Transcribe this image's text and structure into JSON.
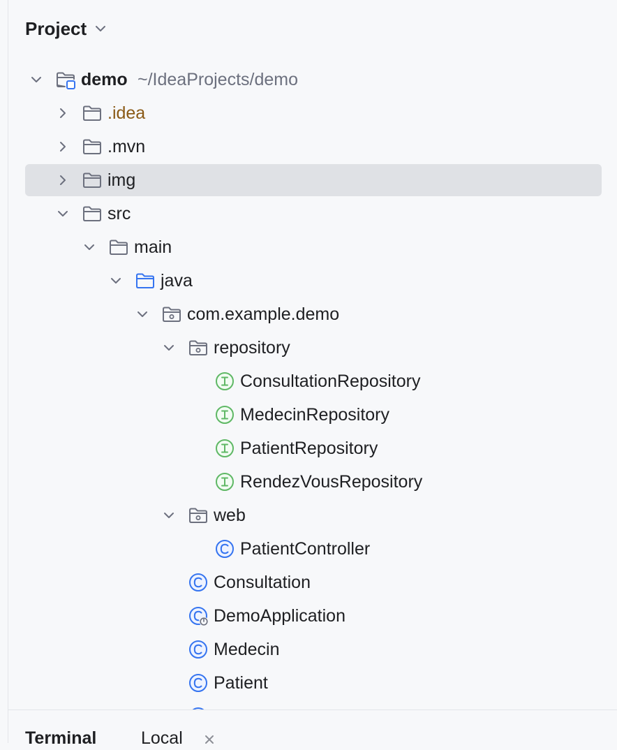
{
  "header": {
    "title": "Project"
  },
  "tree": [
    {
      "label": "demo",
      "hint": "~/IdeaProjects/demo",
      "depth": 0,
      "arrow": "down",
      "icon": "module-folder-icon",
      "bold": true
    },
    {
      "label": ".idea",
      "depth": 1,
      "arrow": "right",
      "icon": "folder-icon",
      "excluded": true
    },
    {
      "label": ".mvn",
      "depth": 1,
      "arrow": "right",
      "icon": "folder-icon"
    },
    {
      "label": "img",
      "depth": 1,
      "arrow": "right",
      "icon": "folder-icon",
      "selected": true
    },
    {
      "label": "src",
      "depth": 1,
      "arrow": "down",
      "icon": "folder-icon"
    },
    {
      "label": "main",
      "depth": 2,
      "arrow": "down",
      "icon": "folder-icon"
    },
    {
      "label": "java",
      "depth": 3,
      "arrow": "down",
      "icon": "source-folder-icon"
    },
    {
      "label": "com.example.demo",
      "depth": 4,
      "arrow": "down",
      "icon": "package-icon"
    },
    {
      "label": "repository",
      "depth": 5,
      "arrow": "down",
      "icon": "package-icon"
    },
    {
      "label": "ConsultationRepository",
      "depth": 6,
      "icon": "interface-icon"
    },
    {
      "label": "MedecinRepository",
      "depth": 6,
      "icon": "interface-icon"
    },
    {
      "label": "PatientRepository",
      "depth": 6,
      "icon": "interface-icon"
    },
    {
      "label": "RendezVousRepository",
      "depth": 6,
      "icon": "interface-icon"
    },
    {
      "label": "web",
      "depth": 5,
      "arrow": "down",
      "icon": "package-icon"
    },
    {
      "label": "PatientController",
      "depth": 6,
      "icon": "class-icon"
    },
    {
      "label": "Consultation",
      "depth": 5,
      "icon": "class-icon"
    },
    {
      "label": "DemoApplication",
      "depth": 5,
      "icon": "spring-class-icon"
    },
    {
      "label": "Medecin",
      "depth": 5,
      "icon": "class-icon"
    },
    {
      "label": "Patient",
      "depth": 5,
      "icon": "class-icon"
    },
    {
      "label": "",
      "depth": 5,
      "icon": "class-icon"
    }
  ],
  "bottom": {
    "terminal": "Terminal",
    "tab": "Local"
  },
  "colors": {
    "selection": "#dfe1e5",
    "folder": "#6c707e",
    "source_folder": "#3574f0",
    "interface": "#5fb865",
    "class": "#3574f0",
    "excluded_text": "#8a5a16"
  }
}
